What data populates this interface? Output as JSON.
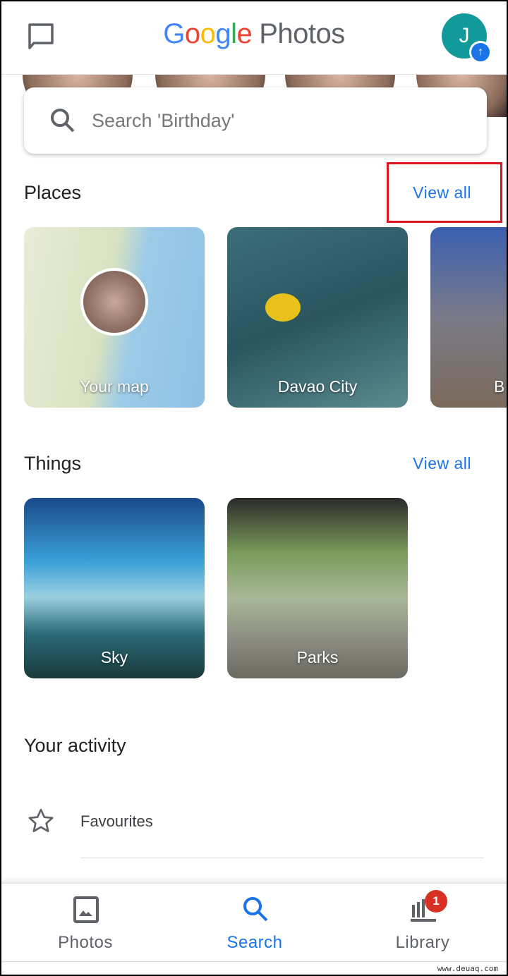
{
  "header": {
    "logo_google": [
      "G",
      "o",
      "o",
      "g",
      "l",
      "e"
    ],
    "logo_photos": "Photos",
    "avatar_initial": "J",
    "icons": {
      "left": "message-icon",
      "badge": "arrow-up-icon"
    }
  },
  "search": {
    "placeholder": "Search 'Birthday'"
  },
  "places": {
    "title": "Places",
    "view_all": "View all",
    "items": [
      {
        "label": "Your map"
      },
      {
        "label": "Davao City"
      },
      {
        "label": "B"
      }
    ]
  },
  "things": {
    "title": "Things",
    "view_all": "View all",
    "items": [
      {
        "label": "Sky"
      },
      {
        "label": "Parks"
      }
    ]
  },
  "activity": {
    "title": "Your activity",
    "items": [
      {
        "label": "Favourites",
        "icon": "star-icon"
      }
    ]
  },
  "nav": {
    "items": [
      {
        "label": "Photos",
        "icon": "photo-icon",
        "active": false
      },
      {
        "label": "Search",
        "icon": "search-icon",
        "active": true
      },
      {
        "label": "Library",
        "icon": "library-icon",
        "active": false,
        "badge": "1"
      }
    ]
  },
  "colors": {
    "accent": "#1a73e8",
    "highlight_box": "#e0141e",
    "badge": "#d93025",
    "avatar": "#129a9a"
  },
  "watermark": "www.deuaq.com"
}
